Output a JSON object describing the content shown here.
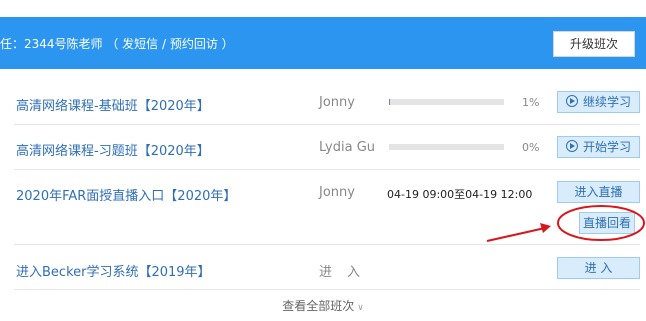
{
  "header": {
    "text": "任：2344号陈老师 （ 发短信 / 预约回访 ）",
    "upgrade_label": "升级班次"
  },
  "courses": [
    {
      "title": "高清网络课程-基础班【2020年】",
      "teacher": "Jonny",
      "progress": 0.01,
      "percent_text": "1%",
      "action": "继续学习",
      "action_icon": "play-circle-icon"
    },
    {
      "title": "高清网络课程-习题班【2020年】",
      "teacher": "Lydia Gu",
      "progress": 0.0,
      "percent_text": "0%",
      "action": "开始学习",
      "action_icon": "play-circle-icon"
    },
    {
      "title": "2020年FAR面授直播入口【2020年】",
      "teacher": "Jonny",
      "schedule": "04-19 09:00至04-19 12:00",
      "action": "进入直播",
      "secondary_action": "直播回看"
    },
    {
      "title": "进入Becker学习系统【2019年】",
      "teacher": "进　入",
      "action": "进 入"
    }
  ],
  "footer": {
    "view_all": "查看全部班次",
    "chevron_icon": "chevron-down-icon"
  },
  "colors": {
    "header_bg": "#2b95f0",
    "link": "#2f6fb7",
    "button_bg": "#d9ecfb",
    "annotation_red": "#d9161c"
  }
}
